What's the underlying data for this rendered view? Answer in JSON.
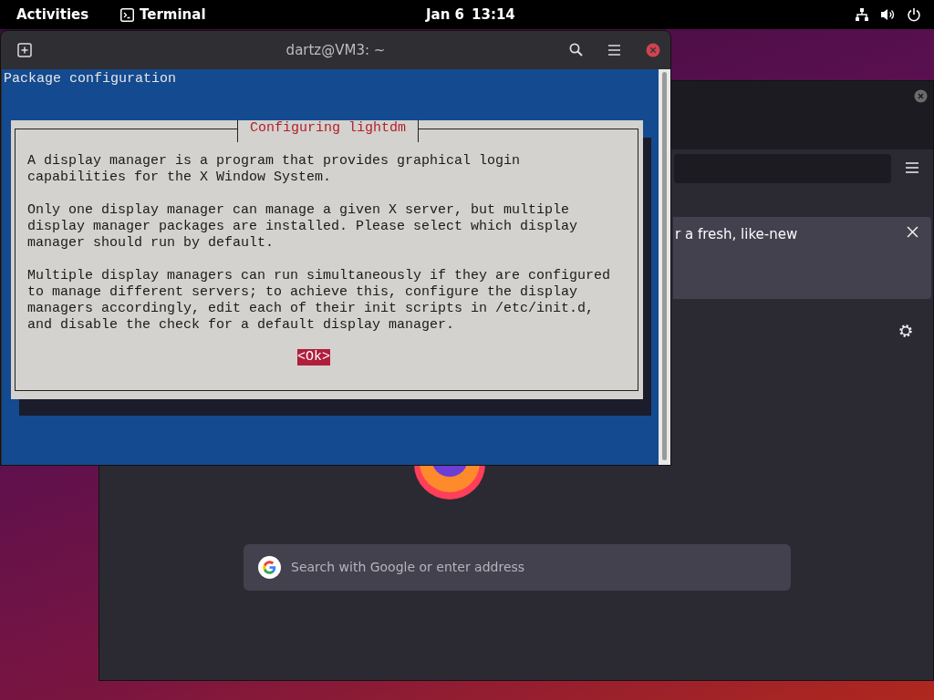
{
  "top_bar": {
    "activities": "Activities",
    "app": "Terminal",
    "date": "Jan 6",
    "time": "13:14"
  },
  "terminal": {
    "title": "dartz@VM3: ~",
    "heading": "Package configuration",
    "dialog": {
      "title": "Configuring lightdm",
      "paragraphs": [
        [
          "A display manager is a program that provides graphical login",
          "capabilities for the X Window System."
        ],
        [
          "Only one display manager can manage a given X server, but multiple",
          "display manager packages are installed. Please select which display",
          "manager should run by default."
        ],
        [
          "Multiple display managers can run simultaneously if they are configured",
          "to manage different servers; to achieve this, configure the display",
          "managers accordingly, edit each of their init scripts in /etc/init.d,",
          "and disable the check for a default display manager."
        ]
      ],
      "buttons": [
        {
          "label": "<Ok>",
          "selected": true
        }
      ]
    }
  },
  "firefox": {
    "notification": "r a fresh, like-new",
    "search": {
      "placeholder": "Search with Google or enter address"
    }
  }
}
